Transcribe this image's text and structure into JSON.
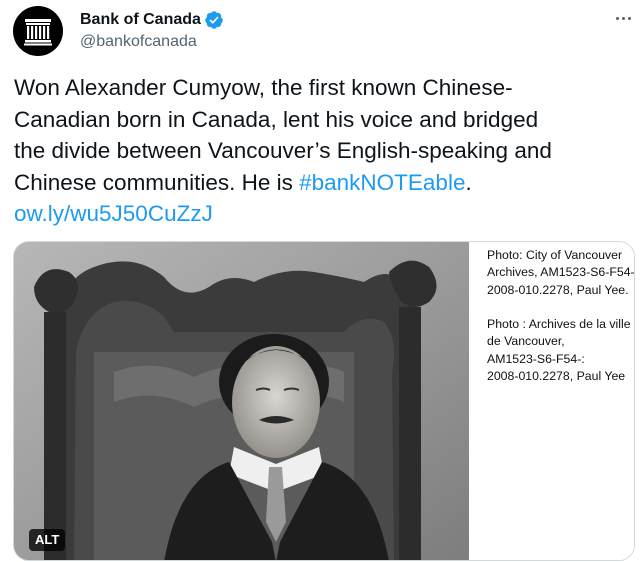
{
  "author": {
    "display_name": "Bank of Canada",
    "handle": "@bankofcanada",
    "avatar_icon": "bank-building-logo-icon",
    "verified_icon": "verified-badge-icon",
    "verified_color": "#1d9bf0"
  },
  "more_icon": "more-options-icon",
  "tweet": {
    "line1": "Won Alexander Cumyow, the first known Chinese-",
    "line2": "Canadian born in Canada, lent his voice and bridged",
    "line3": "the divide between Vancouver’s English-speaking and",
    "line4_text": "Chinese communities. He is ",
    "hashtag": "#bankNOTEable",
    "line4_end": ".",
    "url": "ow.ly/wu5J50CuZzJ"
  },
  "media": {
    "alt_badge": "ALT",
    "photo_subject": "historic-portrait-photo",
    "caption_en": [
      "Photo: City of Vancouver",
      "Archives, AM1523-S6-F54-:",
      "2008-010.2278, Paul Yee."
    ],
    "caption_fr": [
      "Photo : Archives de la ville",
      "de Vancouver,",
      "AM1523-S6-F54-:",
      "2008-010.2278, Paul Yee"
    ]
  },
  "colors": {
    "text": "#0f1419",
    "secondary": "#536471",
    "link": "#1d9bf0",
    "border": "#cfd9de"
  }
}
